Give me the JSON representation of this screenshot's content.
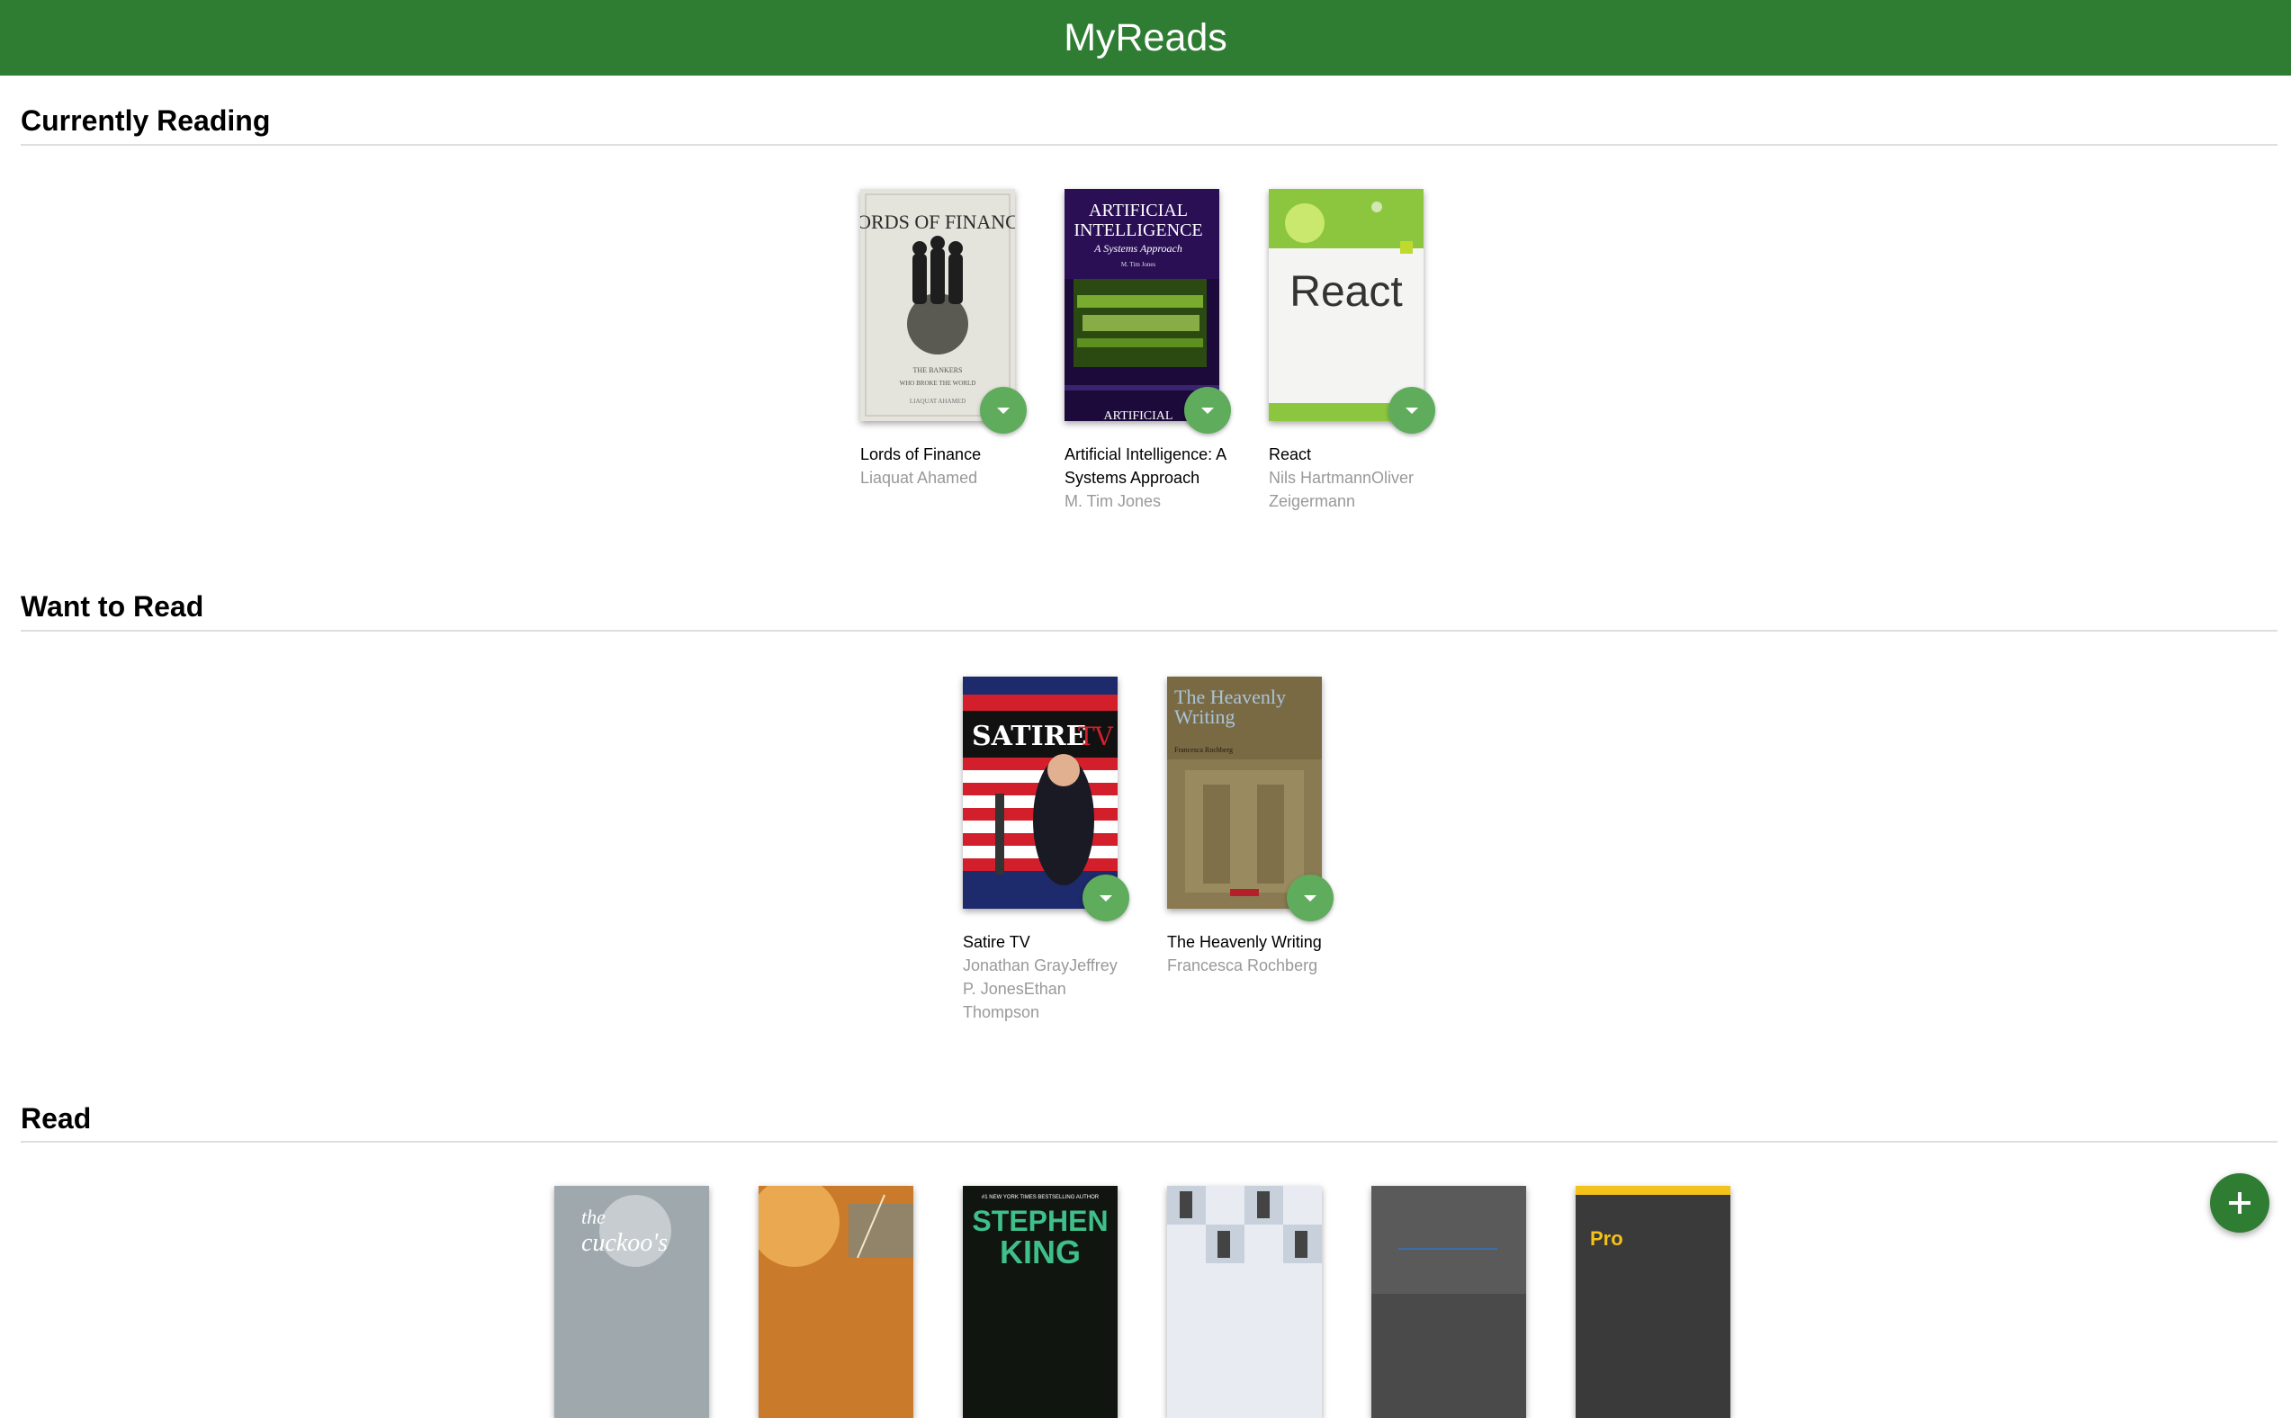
{
  "app": {
    "title": "MyReads"
  },
  "shelves": {
    "currently_reading": {
      "title": "Currently Reading",
      "books": [
        {
          "title": "Lords of Finance",
          "authors": "Liaquat Ahamed",
          "cover_text": [
            "LORDS OF FINANCE",
            "THE BANKERS",
            "WHO BROKE THE WORLD",
            "LIAQUAT AHAMED"
          ]
        },
        {
          "title": "Artificial Intelligence: A Systems Approach",
          "authors": "M. Tim Jones",
          "cover_text": [
            "ARTIFICIAL",
            "INTELLIGENCE",
            "A Systems Approach",
            "M. Tim Jones",
            "ARTIFICIAL"
          ]
        },
        {
          "title": "React",
          "authors": "Nils HartmannOliver Zeigermann",
          "cover_text": [
            "React"
          ]
        }
      ]
    },
    "want_to_read": {
      "title": "Want to Read",
      "books": [
        {
          "title": "Satire TV",
          "authors": "Jonathan GrayJeffrey P. JonesEthan Thompson",
          "cover_text": [
            "SATIRE",
            "TV"
          ]
        },
        {
          "title": "The Heavenly Writing",
          "authors": "Francesca Rochberg",
          "cover_text": [
            "The Heavenly",
            "Writing",
            "Francesca Rochberg"
          ]
        }
      ]
    },
    "read": {
      "title": "Read",
      "books": [
        {
          "cover_text": [
            "the",
            "cuckoo's"
          ]
        },
        {
          "cover_text": []
        },
        {
          "cover_text": [
            "#1 NEW YORK TIMES BESTSELLING AUTHOR",
            "STEPHEN",
            "KING"
          ]
        },
        {
          "cover_text": []
        },
        {
          "cover_text": []
        },
        {
          "cover_text": [
            "Pro"
          ]
        }
      ]
    }
  },
  "colors": {
    "header": "#2e7d32",
    "shelf_changer": "#60ac5d",
    "author_text": "#999999",
    "divider": "#dedede"
  },
  "icons": {
    "shelf_changer": "caret-down-icon",
    "add_book": "plus-icon"
  }
}
